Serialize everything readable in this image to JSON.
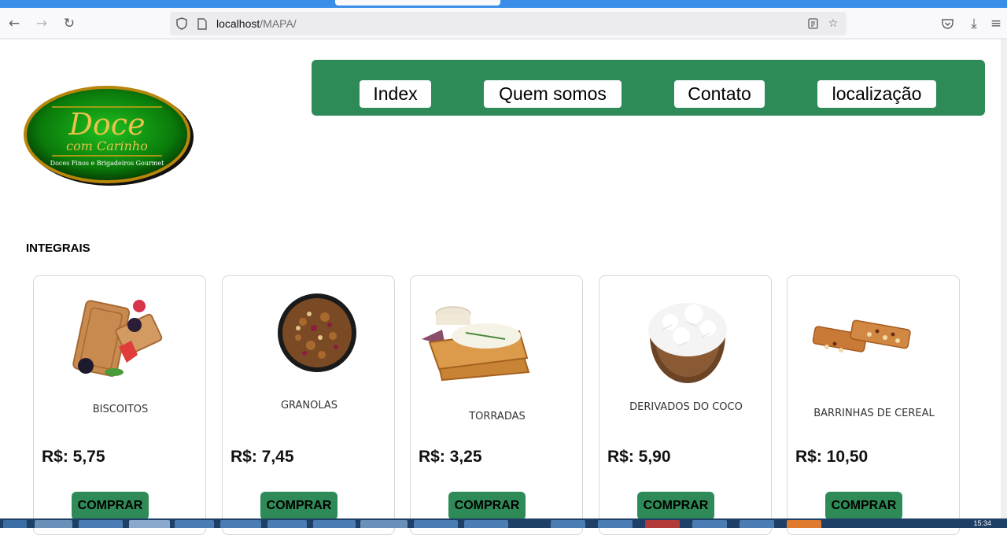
{
  "browser": {
    "url_host": "localhost",
    "url_path": "/MAPA/",
    "icons": [
      "back-icon",
      "forward-icon",
      "reload-icon",
      "shield-icon",
      "page-icon",
      "reader-icon",
      "bookmark-star-icon",
      "pocket-icon",
      "download-icon",
      "menu-icon"
    ]
  },
  "logo": {
    "line1": "Doce",
    "line2": "com Carinho",
    "line3": "Doces Finos e Brigadeiros Gourmet"
  },
  "menu": [
    "Index",
    "Quem somos",
    "Contato",
    "localização"
  ],
  "section": {
    "title": "INTEGRAIS"
  },
  "products": [
    {
      "name": "BISCOITOS",
      "price": "R$: 5,75",
      "button": "COMPRAR"
    },
    {
      "name": "GRANOLAS",
      "price": "R$: 7,45",
      "button": "COMPRAR"
    },
    {
      "name": "TORRADAS",
      "price": "R$: 3,25",
      "button": "COMPRAR"
    },
    {
      "name": "DERIVADOS DO COCO",
      "price": "R$: 5,90",
      "button": "COMPRAR"
    },
    {
      "name": "BARRINHAS DE CEREAL",
      "price": "R$: 10,50",
      "button": "COMPRAR"
    }
  ],
  "colors": {
    "accent": "#2e8b57",
    "browser_bar": "#3b8ee8"
  },
  "taskbar": {
    "clock": "15:34"
  }
}
